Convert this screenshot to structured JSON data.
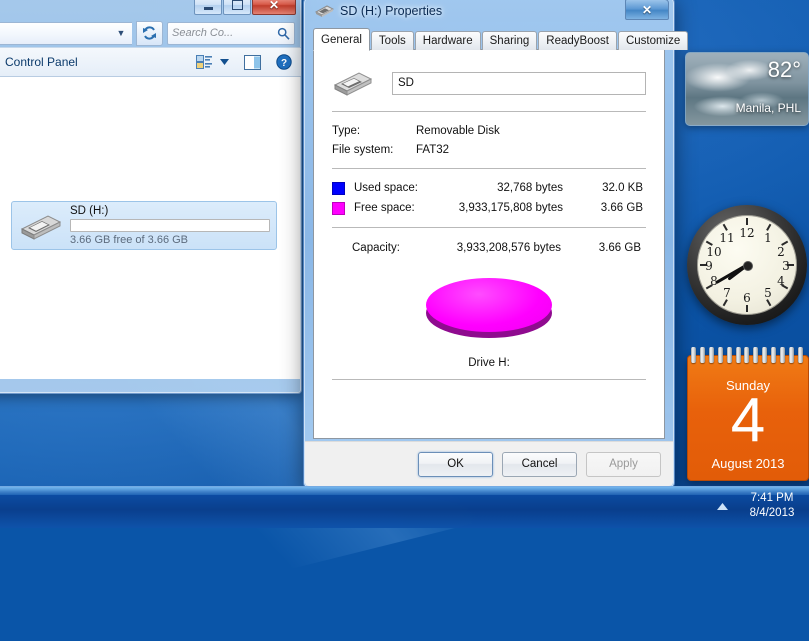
{
  "explorer": {
    "address_value": "",
    "address_chevron_icon": "chevron-down-icon",
    "refresh_icon": "refresh-icon",
    "search_placeholder": "Search Co...",
    "search_icon": "search-icon",
    "toolbar_label": "Control Panel",
    "view_icon": "view-options-icon",
    "view_chevron_icon": "chevron-down-icon",
    "preview_pane_icon": "preview-pane-icon",
    "help_icon": "help-icon",
    "minimize_label": "Minimize",
    "maximize_label": "Maximize",
    "close_label": "Close",
    "drive": {
      "icon": "removable-disk-icon",
      "name": "SD (H:)",
      "subtitle": "3.66 GB free of 3.66 GB",
      "bar_used_percent": 0
    }
  },
  "dialog": {
    "title": "SD (H:) Properties",
    "title_icon": "removable-disk-icon",
    "close_label": "Close",
    "tabs": [
      {
        "label": "General",
        "active": true
      },
      {
        "label": "Tools",
        "active": false
      },
      {
        "label": "Hardware",
        "active": false
      },
      {
        "label": "Sharing",
        "active": false
      },
      {
        "label": "ReadyBoost",
        "active": false
      },
      {
        "label": "Customize",
        "active": false
      }
    ],
    "general": {
      "drive_icon": "removable-disk-icon",
      "label_value": "SD",
      "type_key": "Type:",
      "type_value": "Removable Disk",
      "filesystem_key": "File system:",
      "filesystem_value": "FAT32",
      "used_key": "Used space:",
      "used_bytes": "32,768 bytes",
      "used_human": "32.0 KB",
      "used_color": "#0000ff",
      "free_key": "Free space:",
      "free_bytes": "3,933,175,808 bytes",
      "free_human": "3.66 GB",
      "free_color": "#ff00ff",
      "capacity_key": "Capacity:",
      "capacity_bytes": "3,933,208,576 bytes",
      "capacity_human": "3.66 GB",
      "drive_caption": "Drive H:"
    },
    "buttons": {
      "ok": "OK",
      "cancel": "Cancel",
      "apply": "Apply"
    }
  },
  "gadgets": {
    "weather": {
      "temperature": "82°",
      "location": "Manila, PHL",
      "condition_icon": "cloudy-icon"
    },
    "clock": {
      "numerals": [
        "12",
        "1",
        "2",
        "3",
        "4",
        "5",
        "6",
        "7",
        "8",
        "9",
        "10",
        "11"
      ],
      "hour_angle_deg": 233,
      "minute_angle_deg": 240
    },
    "calendar": {
      "weekday": "Sunday",
      "day": "4",
      "month_year": "August 2013",
      "accent_color": "#e8610b"
    }
  },
  "taskbar": {
    "tray_arrow_icon": "show-hidden-icons-icon",
    "time": "7:41 PM",
    "date": "8/4/2013"
  }
}
